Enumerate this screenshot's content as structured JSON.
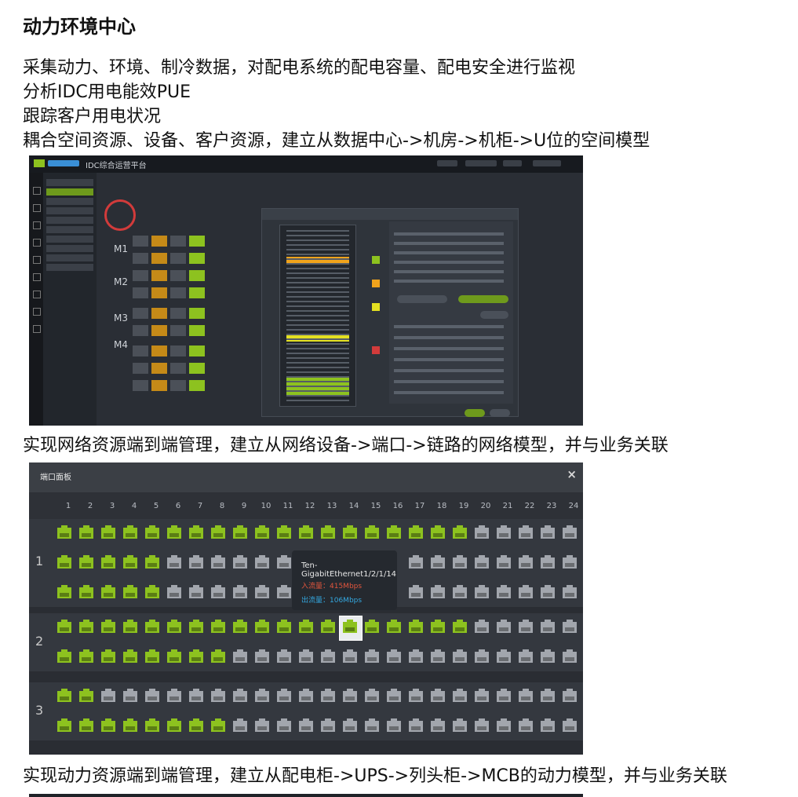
{
  "heading": "动力环境中心",
  "lines": {
    "l1": "采集动力、环境、制冷数据，对配电系统的配电容量、配电安全进行监视",
    "l2": "分析IDC用电能效PUE",
    "l3": "跟踪客户用电状况",
    "l4": "耦合空间资源、设备、客户资源，建立从数据中心->机房->机柜->U位的空间模型",
    "l5": "实现网络资源端到端管理，建立从网络设备->端口->链路的网络模型，并与业务关联",
    "l6": "实现动力资源端到端管理，建立从配电柜->UPS->列头柜->MCB的动力模型，并与业务关联"
  },
  "platform": {
    "title": "IDC综合运营平台",
    "rows": [
      "M1",
      "M2",
      "M3",
      "M4"
    ]
  },
  "port_panel": {
    "title": "端口面板",
    "close": "×",
    "columns": [
      "1",
      "2",
      "3",
      "4",
      "5",
      "6",
      "7",
      "8",
      "9",
      "10",
      "11",
      "12",
      "13",
      "14",
      "15",
      "16",
      "17",
      "18",
      "19",
      "20",
      "21",
      "22",
      "23",
      "24"
    ],
    "groups": [
      "1",
      "2",
      "3"
    ],
    "tooltip": {
      "port_name": "Ten-GigabitEthernet1/2/1/14",
      "in_traffic": "入流量：415Mbps",
      "out_traffic": "出流量：106Mbps"
    },
    "status": {
      "g1_row1_green": 19,
      "g1_row2_green": 5,
      "g2_row1_green": 19,
      "g2_row2_green": 8,
      "g3_row1_green": 2,
      "g3_row2_green": 8,
      "highlighted_port": "14"
    },
    "colors": {
      "active": "#8dc21f",
      "inactive": "#a2a6ad"
    }
  }
}
